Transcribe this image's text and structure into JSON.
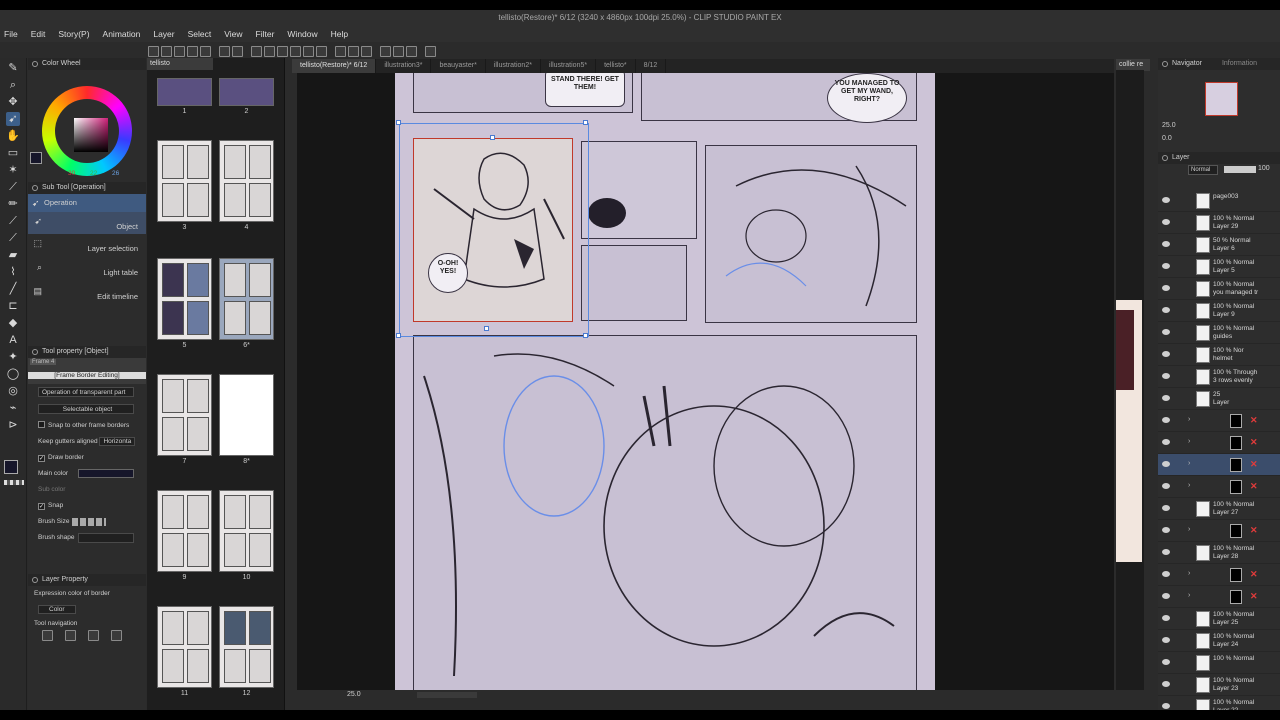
{
  "window": {
    "title": "tellisto(Restore)* 6/12 (3240 x 4860px 100dpi 25.0%) - CLIP STUDIO PAINT EX"
  },
  "menu": [
    "File",
    "Edit",
    "Story(P)",
    "Animation",
    "Layer",
    "Select",
    "View",
    "Filter",
    "Window",
    "Help"
  ],
  "color_wheel": {
    "title": "Color Wheel",
    "h": "30",
    "s": "22",
    "v": "26",
    "current_color": "#16162a"
  },
  "sub_tool": {
    "title": "Sub Tool [Operation]",
    "group": "Operation",
    "items": [
      "Object",
      "Layer selection",
      "Light table",
      "Edit timeline"
    ]
  },
  "tool_property": {
    "title": "Tool property [Object]",
    "frame_label": "Frame 4",
    "mode_label": "[Frame Border Editing]",
    "transparent_select": "Operation of transparent part",
    "selectable_object": "Selectable object",
    "snap_frame_borders": "Snap to other frame borders",
    "keep_gutters": "Keep gutters aligned",
    "keep_gutters_value": "Horizonta",
    "draw_border": "Draw border",
    "main_color": "Main color",
    "sub_color": "Sub color",
    "snap": "Snap",
    "brush_size": "Brush Size",
    "brush_shape": "Brush shape"
  },
  "layer_property": {
    "title": "Layer Property",
    "expression_label": "Expression color of border",
    "expression_value": "Color",
    "tool_navigation": "Tool navigation"
  },
  "pages": [
    {
      "label": "1"
    },
    {
      "label": "2"
    },
    {
      "label": "3"
    },
    {
      "label": "4"
    },
    {
      "label": "5"
    },
    {
      "label": "6*"
    },
    {
      "label": "7"
    },
    {
      "label": "8*"
    },
    {
      "label": "9"
    },
    {
      "label": "10"
    },
    {
      "label": "11"
    },
    {
      "label": "12"
    }
  ],
  "pages_tab": "tellisto",
  "tabs": [
    {
      "label": "tellisto(Restore)* 6/12",
      "active": true
    },
    {
      "label": "illustration3*"
    },
    {
      "label": "beauyaster*"
    },
    {
      "label": "illustration2*"
    },
    {
      "label": "illustration5*"
    },
    {
      "label": "tellisto*"
    },
    {
      "label": "8/12"
    }
  ],
  "side_tab": "collie re",
  "balloons": {
    "top_left": "STAND THERE! GET THEM!",
    "top_right": "YOU MANAGED TO GET MY WAND, RIGHT?",
    "panel_oh": "O-OH! YES!"
  },
  "status": {
    "zoom": "25.0",
    "nav_zoom": "25.0",
    "nav_angle": "0.0"
  },
  "navigator": {
    "title": "Navigator",
    "tab2": "Information"
  },
  "layer_panel": {
    "title": "Layer",
    "blend": "Normal",
    "opacity": "100"
  },
  "layers": [
    {
      "name": "page003",
      "line2": ""
    },
    {
      "name": "100 % Normal",
      "line2": "Layer 29"
    },
    {
      "name": "50 % Normal",
      "line2": "Layer 6"
    },
    {
      "name": "100 % Normal",
      "line2": "Layer 5"
    },
    {
      "name": "100 % Normal",
      "line2": "you managed tr"
    },
    {
      "name": "100 % Normal",
      "line2": "Layer 9"
    },
    {
      "name": "100 % Normal",
      "line2": "guides"
    },
    {
      "name": "100 % Nor",
      "line2": "helmet"
    },
    {
      "name": "100 % Through",
      "line2": "3 rows evenly"
    },
    {
      "name": "25",
      "line2": "Layer"
    },
    {
      "name": "",
      "line2": ""
    },
    {
      "name": "",
      "line2": ""
    },
    {
      "name": "",
      "line2": ""
    },
    {
      "name": "",
      "line2": ""
    },
    {
      "name": "100 % Normal",
      "line2": "Layer 27"
    },
    {
      "name": "",
      "line2": ""
    },
    {
      "name": "100 % Normal",
      "line2": "Layer 28"
    },
    {
      "name": "",
      "line2": ""
    },
    {
      "name": "",
      "line2": ""
    },
    {
      "name": "100 % Normal",
      "line2": "Layer 25"
    },
    {
      "name": "100 % Normal",
      "line2": "Layer 24"
    },
    {
      "name": "100 % Normal",
      "line2": ""
    },
    {
      "name": "100 % Normal",
      "line2": "Layer 23"
    },
    {
      "name": "100 % Normal",
      "line2": "Layer 22"
    }
  ]
}
